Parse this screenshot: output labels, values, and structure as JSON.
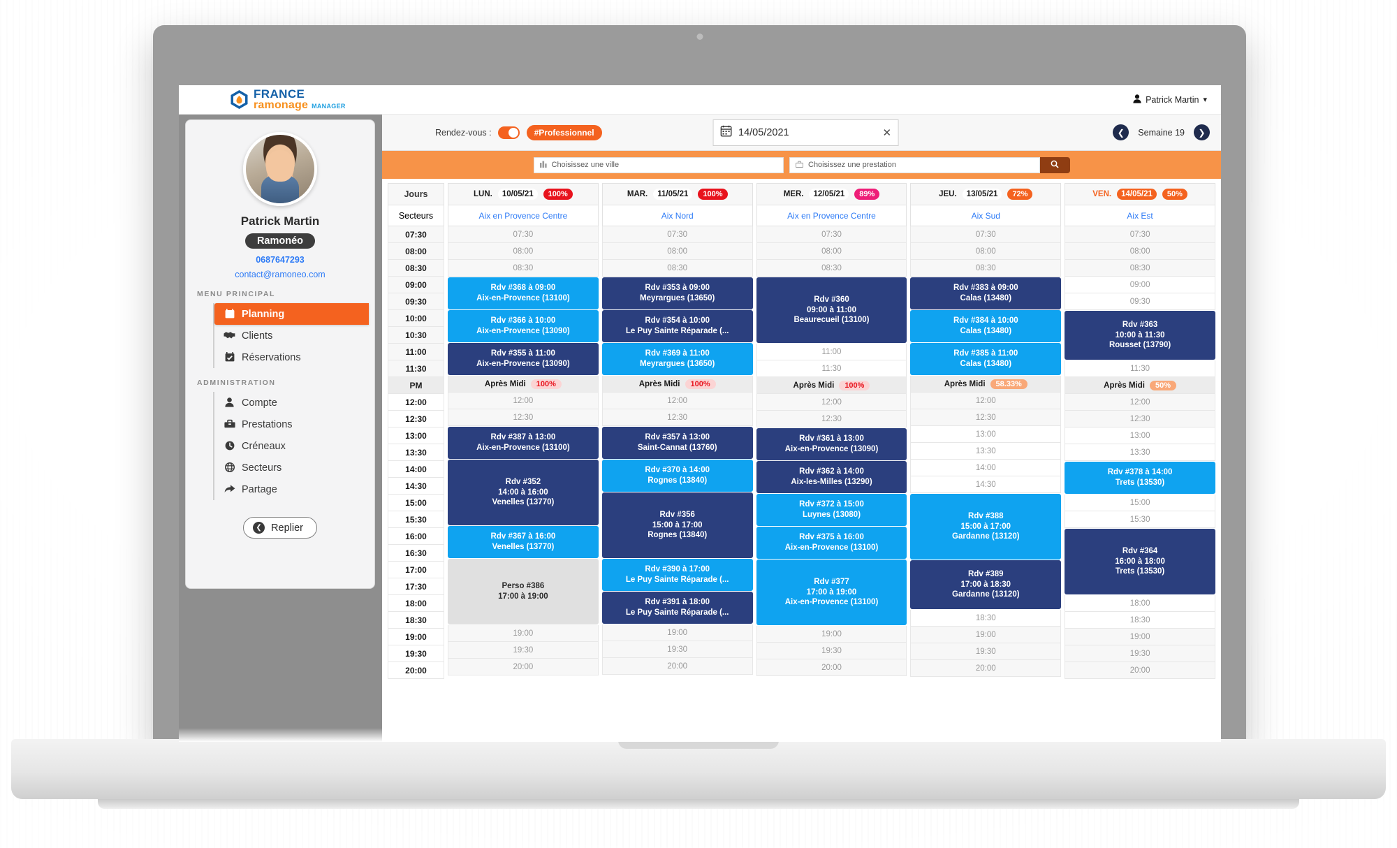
{
  "brand": {
    "line1": "FRANCE",
    "line2": "ramonage",
    "suffix": "MANAGER",
    "accent_blue": "#1461a8",
    "accent_orange": "#f7901e"
  },
  "header": {
    "user_name": "Patrick Martin",
    "user_icon": "person-icon",
    "caret_icon": "chevron-down-icon"
  },
  "sidebar": {
    "avatar_alt": "avatar",
    "profile_name": "Patrick Martin",
    "profile_badge": "Ramonéo",
    "phone": "0687647293",
    "email": "contact@ramoneo.com",
    "section1_title": "MENU PRINCIPAL",
    "section2_title": "ADMINISTRATION",
    "main_items": [
      {
        "label": "Planning",
        "icon": "calendar-icon",
        "active": true
      },
      {
        "label": "Clients",
        "icon": "handshake-icon",
        "active": false
      },
      {
        "label": "Réservations",
        "icon": "calendar-check-icon",
        "active": false
      }
    ],
    "admin_items": [
      {
        "label": "Compte",
        "icon": "user-icon",
        "active": false
      },
      {
        "label": "Prestations",
        "icon": "toolbox-icon",
        "active": false
      },
      {
        "label": "Créneaux",
        "icon": "clock-icon",
        "active": false
      },
      {
        "label": "Secteurs",
        "icon": "globe-icon",
        "active": false
      },
      {
        "label": "Partage",
        "icon": "share-arrow-icon",
        "active": false
      }
    ],
    "collapse_label": "Replier",
    "collapse_icon": "chevron-left-circle-icon"
  },
  "toolbar": {
    "rdv_label": "Rendez-vous :",
    "toggle_on": true,
    "chip_label": "#Professionnel",
    "date_value": "14/05/2021",
    "date_icon": "calendar-icon",
    "clear_icon": "close-icon",
    "prev_icon": "chevron-left-icon",
    "next_icon": "chevron-right-icon",
    "week_label": "Semaine 19"
  },
  "search": {
    "city_placeholder": "Choisissez une ville",
    "city_icon": "city-icon",
    "service_placeholder": "Choisissez une prestation",
    "service_icon": "toolbox-icon",
    "search_icon": "search-icon"
  },
  "calendar": {
    "row_header_days": "Jours",
    "row_header_sectors": "Secteurs",
    "pm_label": "PM",
    "afternoon_label": "Après Midi",
    "time_slots": [
      "07:30",
      "08:00",
      "08:30",
      "09:00",
      "09:30",
      "10:00",
      "10:30",
      "11:00",
      "11:30"
    ],
    "time_slots_pm": [
      "12:00",
      "12:30",
      "13:00",
      "13:30",
      "14:00",
      "14:30",
      "15:00",
      "15:30",
      "16:00",
      "16:30",
      "17:00",
      "17:30",
      "18:00",
      "18:30",
      "19:00",
      "19:30",
      "20:00"
    ],
    "days": [
      {
        "dow": "LUN.",
        "date": "10/05/21",
        "pct": "100%",
        "pct_color": "#e8131d",
        "date_highlight": false,
        "sector": "Aix en Provence Centre",
        "afternoon_pct": "100%",
        "afternoon_pct_color": "#e8131d",
        "afternoon_pct_bg": "#fbd4d4",
        "morning": [
          {
            "type": "slot",
            "label": "07:30"
          },
          {
            "type": "slot",
            "label": "08:00"
          },
          {
            "type": "slot",
            "label": "08:30"
          },
          {
            "type": "event",
            "style": "light",
            "lines": [
              "Rdv #368 à 09:00",
              "Aix-en-Provence (13100)"
            ],
            "span": 2
          },
          {
            "type": "event",
            "style": "light",
            "lines": [
              "Rdv #366 à 10:00",
              "Aix-en-Provence (13090)"
            ],
            "span": 2
          },
          {
            "type": "event",
            "style": "dark",
            "lines": [
              "Rdv #355 à 11:00",
              "Aix-en-Provence (13090)"
            ],
            "span": 2
          }
        ],
        "afternoon": [
          {
            "type": "slot",
            "label": "12:00"
          },
          {
            "type": "slot",
            "label": "12:30"
          },
          {
            "type": "event",
            "style": "dark",
            "lines": [
              "Rdv #387 à 13:00",
              "Aix-en-Provence (13100)"
            ],
            "span": 2
          },
          {
            "type": "event",
            "style": "dark",
            "lines": [
              "Rdv #352",
              "14:00 à 16:00",
              "Venelles (13770)"
            ],
            "span": 4
          },
          {
            "type": "event",
            "style": "light",
            "lines": [
              "Rdv #367 à 16:00",
              "Venelles (13770)"
            ],
            "span": 2
          },
          {
            "type": "event",
            "style": "perso",
            "lines": [
              "Perso #386",
              "17:00 à 19:00"
            ],
            "span": 4
          },
          {
            "type": "slot",
            "label": "19:00"
          },
          {
            "type": "slot",
            "label": "19:30"
          },
          {
            "type": "slot",
            "label": "20:00"
          }
        ]
      },
      {
        "dow": "MAR.",
        "date": "11/05/21",
        "pct": "100%",
        "pct_color": "#e8131d",
        "date_highlight": false,
        "sector": "Aix Nord",
        "afternoon_pct": "100%",
        "afternoon_pct_color": "#e8131d",
        "afternoon_pct_bg": "#fbd4d4",
        "morning": [
          {
            "type": "slot",
            "label": "07:30"
          },
          {
            "type": "slot",
            "label": "08:00"
          },
          {
            "type": "slot",
            "label": "08:30"
          },
          {
            "type": "event",
            "style": "dark",
            "lines": [
              "Rdv #353 à 09:00",
              "Meyrargues (13650)"
            ],
            "span": 2
          },
          {
            "type": "event",
            "style": "dark",
            "lines": [
              "Rdv #354 à 10:00",
              "Le Puy Sainte Réparade (..."
            ],
            "span": 2
          },
          {
            "type": "event",
            "style": "light",
            "lines": [
              "Rdv #369 à 11:00",
              "Meyrargues (13650)"
            ],
            "span": 2
          }
        ],
        "afternoon": [
          {
            "type": "slot",
            "label": "12:00"
          },
          {
            "type": "slot",
            "label": "12:30"
          },
          {
            "type": "event",
            "style": "dark",
            "lines": [
              "Rdv #357 à 13:00",
              "Saint-Cannat (13760)"
            ],
            "span": 2
          },
          {
            "type": "event",
            "style": "light",
            "lines": [
              "Rdv #370 à 14:00",
              "Rognes (13840)"
            ],
            "span": 2
          },
          {
            "type": "event",
            "style": "dark",
            "lines": [
              "Rdv #356",
              "15:00 à 17:00",
              "Rognes (13840)"
            ],
            "span": 4
          },
          {
            "type": "event",
            "style": "light",
            "lines": [
              "Rdv #390 à 17:00",
              "Le Puy Sainte Réparade (..."
            ],
            "span": 2
          },
          {
            "type": "event",
            "style": "dark",
            "lines": [
              "Rdv #391 à 18:00",
              "Le Puy Sainte Réparade (..."
            ],
            "span": 2
          },
          {
            "type": "slot",
            "label": "19:00"
          },
          {
            "type": "slot",
            "label": "19:30"
          },
          {
            "type": "slot",
            "label": "20:00"
          }
        ]
      },
      {
        "dow": "MER.",
        "date": "12/05/21",
        "pct": "89%",
        "pct_color": "#ee1e78",
        "date_highlight": false,
        "sector": "Aix en Provence Centre",
        "afternoon_pct": "100%",
        "afternoon_pct_color": "#e8131d",
        "afternoon_pct_bg": "#fbd4d4",
        "morning": [
          {
            "type": "slot",
            "label": "07:30"
          },
          {
            "type": "slot",
            "label": "08:00"
          },
          {
            "type": "slot",
            "label": "08:30"
          },
          {
            "type": "event",
            "style": "dark",
            "lines": [
              "Rdv #360",
              "09:00 à 11:00",
              "Beaurecueil (13100)"
            ],
            "span": 4
          },
          {
            "type": "slot",
            "label": "11:00",
            "plain": true
          },
          {
            "type": "slot",
            "label": "11:30",
            "plain": true
          }
        ],
        "afternoon": [
          {
            "type": "slot",
            "label": "12:00"
          },
          {
            "type": "slot",
            "label": "12:30"
          },
          {
            "type": "event",
            "style": "dark",
            "lines": [
              "Rdv #361 à 13:00",
              "Aix-en-Provence (13090)"
            ],
            "span": 2
          },
          {
            "type": "event",
            "style": "dark",
            "lines": [
              "Rdv #362 à 14:00",
              "Aix-les-Milles (13290)"
            ],
            "span": 2
          },
          {
            "type": "event",
            "style": "light",
            "lines": [
              "Rdv #372 à 15:00",
              "Luynes (13080)"
            ],
            "span": 2
          },
          {
            "type": "event",
            "style": "light",
            "lines": [
              "Rdv #375 à 16:00",
              "Aix-en-Provence (13100)"
            ],
            "span": 2
          },
          {
            "type": "event",
            "style": "light",
            "lines": [
              "Rdv #377",
              "17:00 à 19:00",
              "Aix-en-Provence (13100)"
            ],
            "span": 4
          },
          {
            "type": "slot",
            "label": "19:00"
          },
          {
            "type": "slot",
            "label": "19:30"
          },
          {
            "type": "slot",
            "label": "20:00"
          }
        ]
      },
      {
        "dow": "JEU.",
        "date": "13/05/21",
        "pct": "72%",
        "pct_color": "#f4621f",
        "date_highlight": false,
        "sector": "Aix Sud",
        "afternoon_pct": "58.33%",
        "afternoon_pct_color": "#ffffff",
        "afternoon_pct_bg": "#f9a878",
        "morning": [
          {
            "type": "slot",
            "label": "07:30"
          },
          {
            "type": "slot",
            "label": "08:00"
          },
          {
            "type": "slot",
            "label": "08:30"
          },
          {
            "type": "event",
            "style": "dark",
            "lines": [
              "Rdv #383 à 09:00",
              "Calas (13480)"
            ],
            "span": 2
          },
          {
            "type": "event",
            "style": "light",
            "lines": [
              "Rdv #384 à 10:00",
              "Calas (13480)"
            ],
            "span": 2
          },
          {
            "type": "event",
            "style": "light",
            "lines": [
              "Rdv #385 à 11:00",
              "Calas (13480)"
            ],
            "span": 2
          }
        ],
        "afternoon": [
          {
            "type": "slot",
            "label": "12:00"
          },
          {
            "type": "slot",
            "label": "12:30"
          },
          {
            "type": "slot",
            "label": "13:00",
            "plain": true
          },
          {
            "type": "slot",
            "label": "13:30",
            "plain": true
          },
          {
            "type": "slot",
            "label": "14:00",
            "plain": true
          },
          {
            "type": "slot",
            "label": "14:30",
            "plain": true
          },
          {
            "type": "event",
            "style": "light",
            "lines": [
              "Rdv #388",
              "15:00 à 17:00",
              "Gardanne (13120)"
            ],
            "span": 4
          },
          {
            "type": "event",
            "style": "dark",
            "lines": [
              "Rdv #389",
              "17:00 à 18:30",
              "Gardanne (13120)"
            ],
            "span": 3
          },
          {
            "type": "slot",
            "label": "18:30",
            "plain": true
          },
          {
            "type": "slot",
            "label": "19:00"
          },
          {
            "type": "slot",
            "label": "19:30"
          },
          {
            "type": "slot",
            "label": "20:00"
          }
        ]
      },
      {
        "dow": "VEN.",
        "date": "14/05/21",
        "pct": "50%",
        "pct_color": "#f4621f",
        "date_highlight": true,
        "sector": "Aix Est",
        "afternoon_pct": "50%",
        "afternoon_pct_color": "#ffffff",
        "afternoon_pct_bg": "#f9a878",
        "morning": [
          {
            "type": "slot",
            "label": "07:30"
          },
          {
            "type": "slot",
            "label": "08:00"
          },
          {
            "type": "slot",
            "label": "08:30"
          },
          {
            "type": "slot",
            "label": "09:00",
            "plain": true
          },
          {
            "type": "slot",
            "label": "09:30",
            "plain": true
          },
          {
            "type": "event",
            "style": "dark",
            "lines": [
              "Rdv #363",
              "10:00 à 11:30",
              "Rousset (13790)"
            ],
            "span": 3
          },
          {
            "type": "slot",
            "label": "11:30",
            "plain": true
          }
        ],
        "afternoon": [
          {
            "type": "slot",
            "label": "12:00"
          },
          {
            "type": "slot",
            "label": "12:30"
          },
          {
            "type": "slot",
            "label": "13:00",
            "plain": true
          },
          {
            "type": "slot",
            "label": "13:30",
            "plain": true
          },
          {
            "type": "event",
            "style": "light",
            "lines": [
              "Rdv #378 à 14:00",
              "Trets (13530)"
            ],
            "span": 2
          },
          {
            "type": "slot",
            "label": "15:00",
            "plain": true
          },
          {
            "type": "slot",
            "label": "15:30",
            "plain": true
          },
          {
            "type": "event",
            "style": "dark",
            "lines": [
              "Rdv #364",
              "16:00 à 18:00",
              "Trets (13530)"
            ],
            "span": 4
          },
          {
            "type": "slot",
            "label": "18:00",
            "plain": true
          },
          {
            "type": "slot",
            "label": "18:30",
            "plain": true
          },
          {
            "type": "slot",
            "label": "19:00"
          },
          {
            "type": "slot",
            "label": "19:30"
          },
          {
            "type": "slot",
            "label": "20:00"
          }
        ]
      }
    ]
  }
}
